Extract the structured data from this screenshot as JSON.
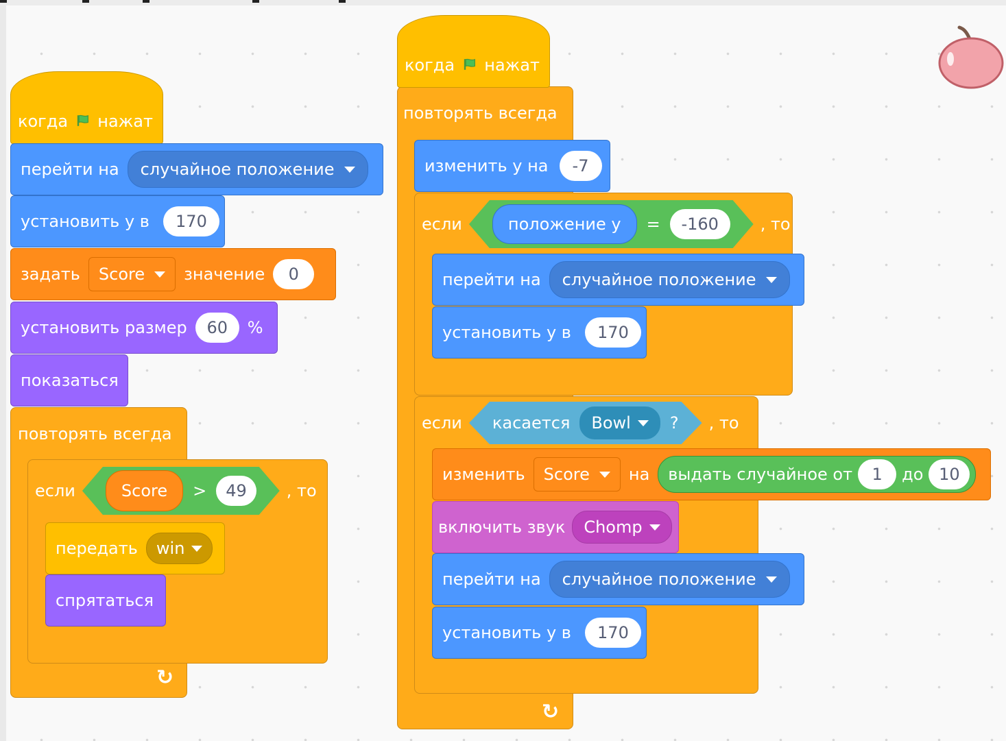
{
  "colors": {
    "events": "#ffbf00",
    "control": "#ffab19",
    "motion": "#4c97ff",
    "variables": "#ff8c1a",
    "looks": "#9966ff",
    "sound": "#cf63cf",
    "sensing": "#5cb1d6",
    "operators": "#59c059",
    "flag": "#4cbf56"
  },
  "sprite": {
    "icon": "apple-icon"
  },
  "script1": {
    "hat": {
      "when": "когда",
      "clicked": "нажат",
      "icon": "green-flag-icon"
    },
    "goto": {
      "label": "перейти на",
      "target": "случайное положение"
    },
    "set_y": {
      "label": "установить у в",
      "value": "170"
    },
    "set_var": {
      "label": "задать",
      "var": "Score",
      "to": "значение",
      "value": "0"
    },
    "set_size": {
      "label": "установить размер",
      "value": "60",
      "unit": "%"
    },
    "show": {
      "label": "показаться"
    },
    "forever": {
      "label": "повторять всегда",
      "icon": "loop-arrow-icon"
    },
    "if": {
      "label": "если",
      "then": ", то",
      "left": "Score",
      "op": ">",
      "right": "49"
    },
    "broadcast": {
      "label": "передать",
      "message": "win"
    },
    "hide": {
      "label": "спрятаться"
    }
  },
  "script2": {
    "hat": {
      "when": "когда",
      "clicked": "нажат",
      "icon": "green-flag-icon"
    },
    "forever": {
      "label": "повторять всегда",
      "icon": "loop-arrow-icon"
    },
    "change_y": {
      "label": "изменить у на",
      "value": "-7"
    },
    "if1": {
      "label": "если",
      "then": ", то",
      "left": "положение у",
      "op": "=",
      "right": "-160",
      "goto": {
        "label": "перейти на",
        "target": "случайное положение"
      },
      "set_y": {
        "label": "установить у в",
        "value": "170"
      }
    },
    "if2": {
      "label": "если",
      "then": ", то",
      "sensing": {
        "label": "касается",
        "object": "Bowl",
        "q": "?"
      },
      "change_var": {
        "label": "изменить",
        "var": "Score",
        "by": "на",
        "random": {
          "label": "выдать случайное от",
          "from": "1",
          "to_label": "до",
          "to": "10"
        }
      },
      "sound": {
        "label": "включить звук",
        "sound": "Chomp"
      },
      "goto": {
        "label": "перейти на",
        "target": "случайное положение"
      },
      "set_y": {
        "label": "установить у в",
        "value": "170"
      }
    }
  }
}
